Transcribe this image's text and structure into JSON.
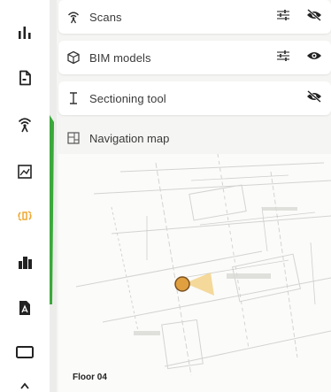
{
  "layers": {
    "scans": {
      "label": "Scans"
    },
    "bim_models": {
      "label": "BIM models"
    },
    "sectioning_tool": {
      "label": "Sectioning tool"
    }
  },
  "navigation_map": {
    "title": "Navigation map",
    "floor_label": "Floor 04"
  },
  "rail": {
    "items": [
      {
        "icon": "bar-chart-icon"
      },
      {
        "icon": "document-icon"
      },
      {
        "icon": "scan-signal-icon"
      },
      {
        "icon": "image-icon"
      },
      {
        "icon": "rotate-3d-icon",
        "active": true
      },
      {
        "icon": "buildings-icon"
      },
      {
        "icon": "pdf-file-icon"
      },
      {
        "icon": "rectangle-icon"
      }
    ],
    "active_color": "#f0a830"
  },
  "colors": {
    "accent_green": "#3aa83a",
    "marker_orange": "#e0a040"
  }
}
